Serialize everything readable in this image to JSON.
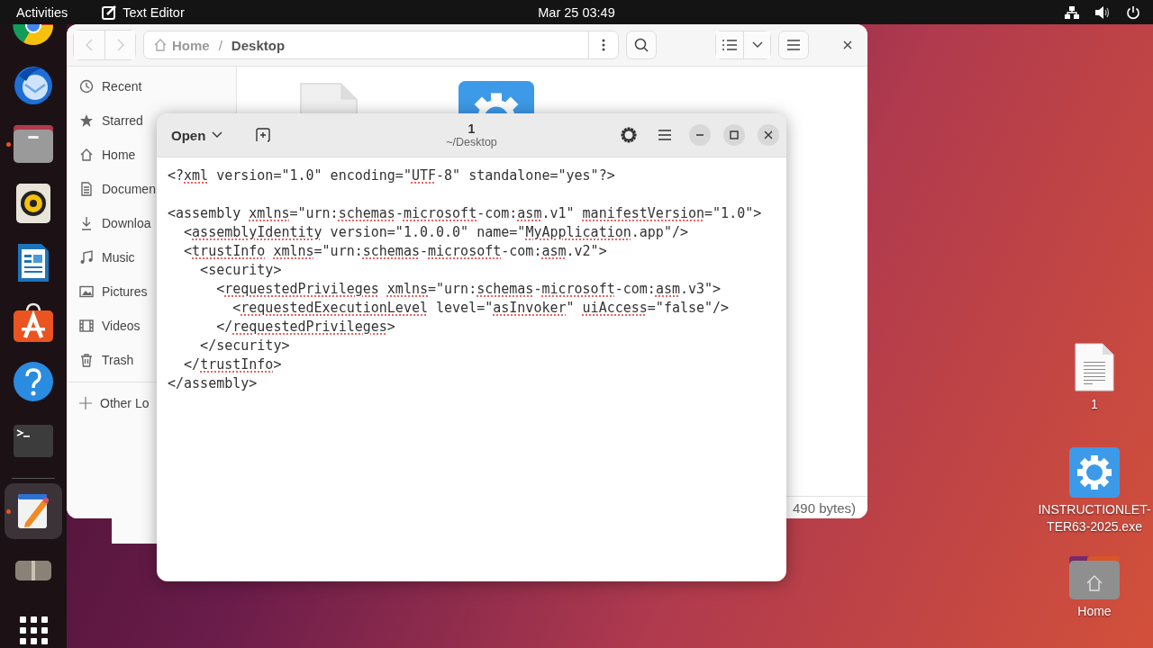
{
  "top_bar": {
    "activities": "Activities",
    "app_name": "Text Editor",
    "clock": "Mar 25  03:49"
  },
  "dock": [
    {
      "kind": "chrome",
      "running": false,
      "active": false
    },
    {
      "kind": "mail",
      "running": false,
      "active": false
    },
    {
      "kind": "files",
      "running": true,
      "active": false
    },
    {
      "kind": "speaker",
      "running": false,
      "active": false
    },
    {
      "kind": "writer",
      "running": false,
      "active": false
    },
    {
      "kind": "store",
      "running": false,
      "active": false
    },
    {
      "kind": "help",
      "running": false,
      "active": false
    },
    {
      "kind": "terminal",
      "running": false,
      "active": false
    },
    {
      "kind": "separator"
    },
    {
      "kind": "editor",
      "running": true,
      "active": true
    },
    {
      "kind": "archive",
      "running": false,
      "active": false
    },
    {
      "kind": "grid",
      "running": false,
      "active": false
    }
  ],
  "file_manager": {
    "path": [
      {
        "label": "Home",
        "selected": false
      },
      {
        "label": "Desktop",
        "selected": true
      }
    ],
    "path_separator": "/",
    "sidebar": [
      {
        "kind": "recent",
        "label": "Recent"
      },
      {
        "kind": "star",
        "label": "Starred"
      },
      {
        "kind": "home",
        "label": "Home"
      },
      {
        "kind": "document",
        "label": "Documen"
      },
      {
        "kind": "download",
        "label": "Downloa"
      },
      {
        "kind": "music",
        "label": "Music"
      },
      {
        "kind": "pictures",
        "label": "Pictures"
      },
      {
        "kind": "videos",
        "label": "Videos"
      },
      {
        "kind": "trash",
        "label": "Trash"
      }
    ],
    "other_locations": "Other Lo",
    "files": [
      {
        "kind": "document"
      },
      {
        "kind": "gear"
      }
    ],
    "status": "490 bytes)"
  },
  "editor": {
    "open_label": "Open",
    "title": "1",
    "subtitle": "~/Desktop",
    "lines": [
      {
        "kind": "code",
        "text": "<?*xml* version=\"1.0\" encoding=\"*UTF*-8\" standalone=\"yes\"?>"
      },
      {
        "kind": "blank"
      },
      {
        "kind": "code",
        "text": "<assembly *xmlns*=\"urn:*schemas*-*microsoft*-com:*asm*.v1\" *manifestVersion*=\"1.0\">"
      },
      {
        "kind": "code",
        "text": "  <*assemblyIdentity* version=\"1.0.0.0\" name=\"*MyApplication*.app\"/>"
      },
      {
        "kind": "code",
        "text": "  <*trustInfo* *xmlns*=\"urn:*schemas*-*microsoft*-com:*asm*.v2\">"
      },
      {
        "kind": "code",
        "text": "    <security>"
      },
      {
        "kind": "code",
        "text": "      <*requestedPrivileges* *xmlns*=\"urn:*schemas*-*microsoft*-com:*asm*.v3\">"
      },
      {
        "kind": "code",
        "text": "        <*requestedExecutionLevel* level=\"*asInvoker*\" *uiAccess*=\"false\"/>"
      },
      {
        "kind": "code",
        "text": "      </*requestedPrivileges*>"
      },
      {
        "kind": "code",
        "text": "    </security>"
      },
      {
        "kind": "code",
        "text": "  </*trustInfo*>"
      },
      {
        "kind": "code",
        "text": "</assembly>"
      }
    ]
  },
  "desktop_icons": [
    {
      "kind": "document",
      "label": "1"
    },
    {
      "kind": "gear",
      "label": "INSTRUCTIONLET-TER63-2025.exe"
    },
    {
      "kind": "home_folder",
      "label": "Home"
    }
  ]
}
